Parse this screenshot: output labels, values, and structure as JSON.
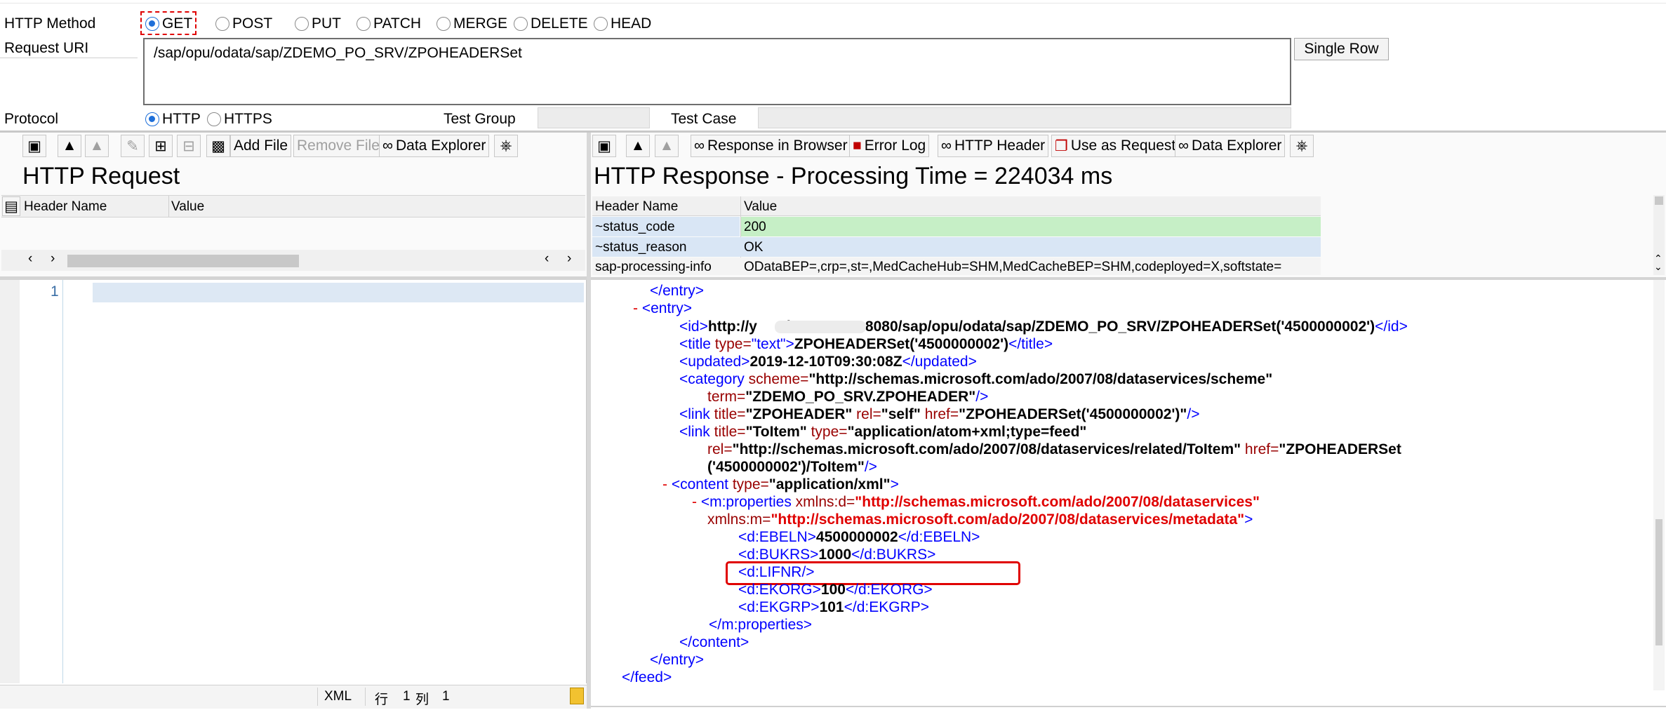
{
  "top": {
    "method_label": "HTTP Method",
    "methods": [
      "GET",
      "POST",
      "PUT",
      "PATCH",
      "MERGE",
      "DELETE",
      "HEAD"
    ],
    "selected_method": "GET",
    "uri_label": "Request URI",
    "uri_value": "/sap/opu/odata/sap/ZDEMO_PO_SRV/ZPOHEADERSet",
    "single_row_button": "Single Row",
    "protocol_label": "Protocol",
    "protocols": [
      "HTTP",
      "HTTPS"
    ],
    "selected_protocol": "HTTP",
    "test_group_label": "Test Group",
    "test_group_value": "",
    "test_case_label": "Test Case",
    "test_case_value": ""
  },
  "request": {
    "toolbar": {
      "add_file": "Add File",
      "remove_file": "Remove File",
      "data_explorer": "Data Explorer"
    },
    "title": "HTTP Request",
    "columns": [
      "Header Name",
      "Value"
    ],
    "editor_line": "1",
    "status": {
      "format": "XML",
      "row_label": "行",
      "row_value": "1",
      "col_label": "列",
      "col_value": "1"
    }
  },
  "response": {
    "toolbar": {
      "response_in_browser": "Response in Browser",
      "error_log": "Error Log",
      "http_header": "HTTP Header",
      "use_as_request": "Use as Request",
      "data_explorer": "Data Explorer"
    },
    "title": "HTTP Response - Processing Time = 224034  ms",
    "columns": [
      "Header Name",
      "Value"
    ],
    "headers": [
      {
        "name": "~status_code",
        "value": "200"
      },
      {
        "name": "~status_reason",
        "value": "OK"
      },
      {
        "name": "sap-processing-info",
        "value": "ODataBEP=,crp=,st=,MedCacheHub=SHM,MedCacheBEP=SHM,codeployed=X,softstate="
      }
    ],
    "xml": {
      "entry_close": "</entry>",
      "minus": "-",
      "entry_open": "<entry>",
      "id_open": "<id>",
      "id_text": "http://y      d01.        cc:8080/sap/opu/odata/sap/ZDEMO_PO_SRV/ZPOHEADERSet('4500000002')",
      "id_close": "</id>",
      "title_open": "<title",
      "title_attr": " type=",
      "title_attr_val": "\"text\"",
      "title_gt": ">",
      "title_text": "ZPOHEADERSet('4500000002')",
      "title_close": "</title>",
      "updated_open": "<updated>",
      "updated_text": "2019-12-10T09:30:08Z",
      "updated_close": "</updated>",
      "category_open": "<category",
      "category_attr": " scheme=",
      "category_scheme": "\"http://schemas.microsoft.com/ado/2007/08/dataservices/scheme\"",
      "category_term_attr": "term=",
      "category_term": "\"ZDEMO_PO_SRV.ZPOHEADER\"",
      "category_end": "/>",
      "link1_open": "<link",
      "link1_title_attr": " title=",
      "link1_title": "\"ZPOHEADER\"",
      "link1_rel_attr": " rel=",
      "link1_rel": "\"self\"",
      "link1_href_attr": " href=",
      "link1_href": "\"ZPOHEADERSet('4500000002')\"",
      "link1_end": "/>",
      "link2_open": "<link",
      "link2_title_attr": " title=",
      "link2_title": "\"ToItem\"",
      "link2_type_attr": " type=",
      "link2_type": "\"application/atom+xml;type=feed\"",
      "link2_rel_attr": "rel=",
      "link2_rel": "\"http://schemas.microsoft.com/ado/2007/08/dataservices/related/ToItem\"",
      "link2_href_attr": " href=",
      "link2_href_a": "\"ZPOHEADERSet",
      "link2_href_b": "('4500000002')/ToItem\"",
      "link2_end": "/>",
      "content_open": "<content",
      "content_attr": " type=",
      "content_type": "\"application/xml\"",
      "content_gt": ">",
      "props_open": "<m:properties",
      "props_xmlns_d_attr": " xmlns:d=",
      "props_xmlns_d": "\"http://schemas.microsoft.com/ado/2007/08/dataservices\"",
      "props_xmlns_m_attr": "xmlns:m=",
      "props_xmlns_m": "\"http://schemas.microsoft.com/ado/2007/08/dataservices/metadata\"",
      "props_gt": ">",
      "ebeln_open": "<d:EBELN>",
      "ebeln_val": "4500000002",
      "ebeln_close": "</d:EBELN>",
      "bukrs_open": "<d:BUKRS>",
      "bukrs_val": "1000",
      "bukrs_close": "</d:BUKRS>",
      "lifnr": "<d:LIFNR/>",
      "ekorg_open": "<d:EKORG>",
      "ekorg_val": "100",
      "ekorg_close": "</d:EKORG>",
      "ekgrp_open": "<d:EKGRP>",
      "ekgrp_val": "101",
      "ekgrp_close": "</d:EKGRP>",
      "props_close": "</m:properties>",
      "content_close": "</content>",
      "entry_close2": "</entry>",
      "feed_close": "</feed>"
    }
  },
  "colors": {
    "highlight_red": "#e00000",
    "status_ok_bg": "#c6efc6",
    "row_blue_bg": "#d9e6f5"
  }
}
